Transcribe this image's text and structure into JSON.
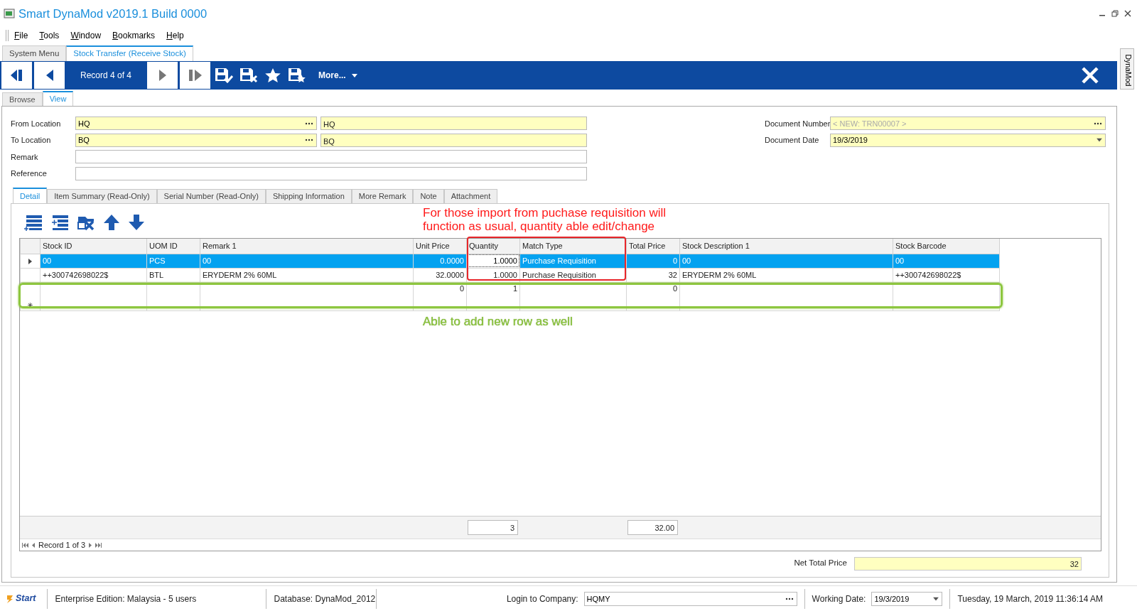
{
  "window": {
    "title": "Smart DynaMod v2019.1 Build 0000"
  },
  "menu": [
    {
      "label": "File"
    },
    {
      "label": "Tools"
    },
    {
      "label": "Window"
    },
    {
      "label": "Bookmarks"
    },
    {
      "label": "Help"
    }
  ],
  "doc_tabs": [
    {
      "label": "System Menu",
      "selected": false
    },
    {
      "label": "Stock Transfer (Receive Stock)",
      "selected": true
    }
  ],
  "toolbar": {
    "record": "Record 4 of 4",
    "more": "More..."
  },
  "side_tab": {
    "label": "DynaMod"
  },
  "view_tabs": [
    {
      "label": "Browse",
      "selected": false
    },
    {
      "label": "View",
      "selected": true
    }
  ],
  "header_fields": [
    {
      "label": "From Location",
      "kind": "lookup",
      "value": "HQ",
      "description": "HQ"
    },
    {
      "label": "To Location",
      "kind": "lookup",
      "value": "BQ",
      "description": "BQ"
    },
    {
      "label": "Remark",
      "kind": "text"
    },
    {
      "label": "Reference",
      "kind": "text"
    }
  ],
  "document_fields": [
    {
      "label": "Document Number",
      "kind": "lookup",
      "placeholder": "< NEW: TRN00007 >"
    },
    {
      "label": "Document Date",
      "kind": "date",
      "value": "19/3/2019"
    }
  ],
  "detail_tabs": [
    {
      "label": "Detail",
      "selected": true
    },
    {
      "label": "Item Summary (Read-Only)",
      "selected": false
    },
    {
      "label": "Serial Number (Read-Only)",
      "selected": false
    },
    {
      "label": "Shipping Information",
      "selected": false
    },
    {
      "label": "More Remark",
      "selected": false
    },
    {
      "label": "Note",
      "selected": false
    },
    {
      "label": "Attachment",
      "selected": false
    }
  ],
  "grid": {
    "columns": [
      "Stock ID",
      "UOM ID",
      "Remark 1",
      "Unit Price",
      "Quantity",
      "Match Type",
      "Total Price",
      "Stock Description 1",
      "Stock Barcode"
    ],
    "rows": [
      {
        "selected": true,
        "quantity_focused": true,
        "stock_id": "00",
        "uom_id": "PCS",
        "remark_1": "00",
        "unit_price": "0.0000",
        "quantity": "1.0000",
        "match_type": "Purchase Requisition",
        "total_price": "0",
        "stock_description_1": "00",
        "stock_barcode": "00"
      },
      {
        "selected": false,
        "quantity_focused": false,
        "stock_id": "++300742698022$",
        "uom_id": "BTL",
        "remark_1": "ERYDERM 2% 60ML",
        "unit_price": "32.0000",
        "quantity": "1.0000",
        "match_type": "Purchase Requisition",
        "total_price": "32",
        "stock_description_1": "ERYDERM 2% 60ML",
        "stock_barcode": "++300742698022$"
      }
    ],
    "new_row": {
      "unit_price": "0",
      "quantity": "1",
      "total_price": "0"
    },
    "totals": {
      "quantity": "3",
      "total_price": "32.00"
    },
    "navigator": "Record 1 of 3"
  },
  "annotations": [
    {
      "kind": "note",
      "text": "For those import from puchase requisition will\nfunction as usual, quantity able edit/change",
      "color": "#ff1a1a"
    },
    {
      "kind": "frame",
      "color": "#e8262a"
    },
    {
      "kind": "frame",
      "color": "#8dc63f"
    },
    {
      "kind": "note",
      "text": "Able to add new row as well",
      "color": "#8dc63f"
    }
  ],
  "net_total": {
    "label": "Net Total Price",
    "value": "32"
  },
  "status_bar": {
    "start": "Start",
    "edition": "Enterprise Edition: Malaysia - 5 users",
    "database": "Database: DynaMod_2012",
    "company_label": "Login to Company:",
    "company": "HQMY",
    "working_date_label": "Working Date:",
    "working_date": "19/3/2019",
    "datetime": "Tuesday, 19 March, 2019 11:36:14 AM"
  }
}
